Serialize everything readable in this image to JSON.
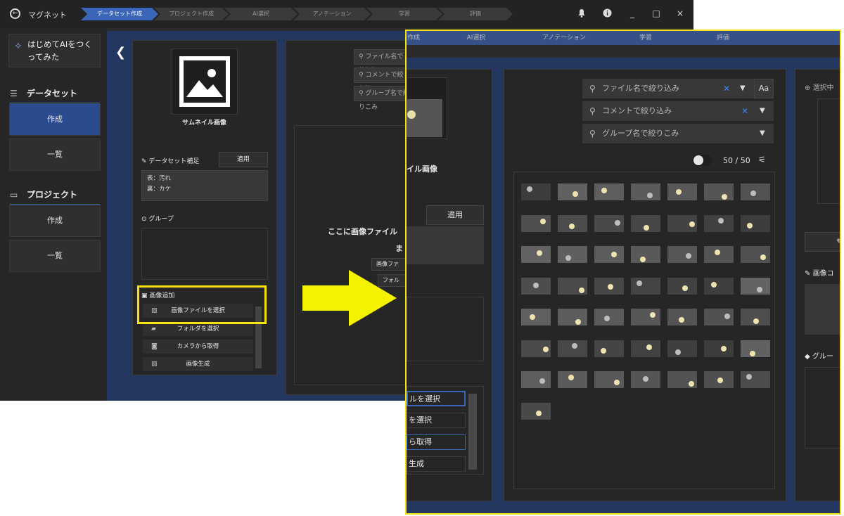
{
  "app": {
    "title": "マグネット"
  },
  "steps": [
    "データセット作成",
    "プロジェクト作成",
    "AI選択",
    "アノテーション",
    "学習",
    "評価"
  ],
  "window_icons": {
    "bell": "bell-icon",
    "info": "info-icon",
    "min": "_",
    "max": "□",
    "close": "×"
  },
  "sidebar": {
    "logo_text": "はじめてAIをつくってみた",
    "sections": [
      {
        "label": "データセット",
        "icon": "database-icon",
        "items": [
          "作成",
          "一覧"
        ]
      },
      {
        "label": "プロジェクト",
        "icon": "project-icon",
        "items": [
          "作成",
          "一覧"
        ]
      }
    ]
  },
  "left_panel": {
    "thumbnail_label": "サムネイル画像",
    "supplement_label": "データセット補足",
    "apply_label": "適用",
    "supplement_text": [
      "表：汚れ",
      "裏：カケ"
    ],
    "group_label": "グループ",
    "add_image_label": "画像追加",
    "add_options": [
      "画像ファイルを選択",
      "フォルダを選択",
      "カメラから取得",
      "画像生成"
    ]
  },
  "middle_panel": {
    "search_filename": "ファイル名で絞り込み",
    "search_comment": "コメントで絞り込み",
    "search_group": "グループ名で絞りこみ",
    "drop_text_1": "ここに画像ファイル",
    "drop_text_2": "ま",
    "drop_btn_file": "画像ファ",
    "drop_btn_folder": "フォル"
  },
  "zoom": {
    "steps": [
      "作成",
      "AI選択",
      "アノテーション",
      "学習",
      "評価"
    ],
    "search_filename": "ファイル名で絞り込み",
    "search_comment": "コメントで絞り込み",
    "search_group": "グループ名で絞りこみ",
    "case_label": "Aa",
    "count": "50 / 50",
    "thumb_label": "イル画像",
    "apply_label": "適用",
    "list_items": [
      "ルを選択",
      "を選択",
      "ら取得",
      "生成"
    ],
    "right_selected": "選択中",
    "right_image_comment": "画像コ",
    "right_group": "グルー"
  },
  "accent": "#3b66b8",
  "highlight_color": "#f5e30f"
}
